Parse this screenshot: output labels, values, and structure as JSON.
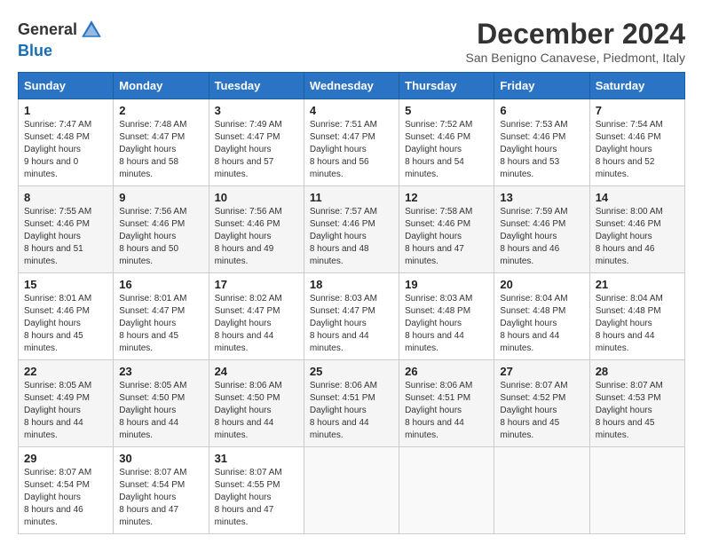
{
  "header": {
    "logo_line1": "General",
    "logo_line2": "Blue",
    "month_title": "December 2024",
    "location": "San Benigno Canavese, Piedmont, Italy"
  },
  "weekdays": [
    "Sunday",
    "Monday",
    "Tuesday",
    "Wednesday",
    "Thursday",
    "Friday",
    "Saturday"
  ],
  "weeks": [
    [
      {
        "day": "1",
        "sunrise": "7:47 AM",
        "sunset": "4:48 PM",
        "daylight": "9 hours and 0 minutes."
      },
      {
        "day": "2",
        "sunrise": "7:48 AM",
        "sunset": "4:47 PM",
        "daylight": "8 hours and 58 minutes."
      },
      {
        "day": "3",
        "sunrise": "7:49 AM",
        "sunset": "4:47 PM",
        "daylight": "8 hours and 57 minutes."
      },
      {
        "day": "4",
        "sunrise": "7:51 AM",
        "sunset": "4:47 PM",
        "daylight": "8 hours and 56 minutes."
      },
      {
        "day": "5",
        "sunrise": "7:52 AM",
        "sunset": "4:46 PM",
        "daylight": "8 hours and 54 minutes."
      },
      {
        "day": "6",
        "sunrise": "7:53 AM",
        "sunset": "4:46 PM",
        "daylight": "8 hours and 53 minutes."
      },
      {
        "day": "7",
        "sunrise": "7:54 AM",
        "sunset": "4:46 PM",
        "daylight": "8 hours and 52 minutes."
      }
    ],
    [
      {
        "day": "8",
        "sunrise": "7:55 AM",
        "sunset": "4:46 PM",
        "daylight": "8 hours and 51 minutes."
      },
      {
        "day": "9",
        "sunrise": "7:56 AM",
        "sunset": "4:46 PM",
        "daylight": "8 hours and 50 minutes."
      },
      {
        "day": "10",
        "sunrise": "7:56 AM",
        "sunset": "4:46 PM",
        "daylight": "8 hours and 49 minutes."
      },
      {
        "day": "11",
        "sunrise": "7:57 AM",
        "sunset": "4:46 PM",
        "daylight": "8 hours and 48 minutes."
      },
      {
        "day": "12",
        "sunrise": "7:58 AM",
        "sunset": "4:46 PM",
        "daylight": "8 hours and 47 minutes."
      },
      {
        "day": "13",
        "sunrise": "7:59 AM",
        "sunset": "4:46 PM",
        "daylight": "8 hours and 46 minutes."
      },
      {
        "day": "14",
        "sunrise": "8:00 AM",
        "sunset": "4:46 PM",
        "daylight": "8 hours and 46 minutes."
      }
    ],
    [
      {
        "day": "15",
        "sunrise": "8:01 AM",
        "sunset": "4:46 PM",
        "daylight": "8 hours and 45 minutes."
      },
      {
        "day": "16",
        "sunrise": "8:01 AM",
        "sunset": "4:47 PM",
        "daylight": "8 hours and 45 minutes."
      },
      {
        "day": "17",
        "sunrise": "8:02 AM",
        "sunset": "4:47 PM",
        "daylight": "8 hours and 44 minutes."
      },
      {
        "day": "18",
        "sunrise": "8:03 AM",
        "sunset": "4:47 PM",
        "daylight": "8 hours and 44 minutes."
      },
      {
        "day": "19",
        "sunrise": "8:03 AM",
        "sunset": "4:48 PM",
        "daylight": "8 hours and 44 minutes."
      },
      {
        "day": "20",
        "sunrise": "8:04 AM",
        "sunset": "4:48 PM",
        "daylight": "8 hours and 44 minutes."
      },
      {
        "day": "21",
        "sunrise": "8:04 AM",
        "sunset": "4:48 PM",
        "daylight": "8 hours and 44 minutes."
      }
    ],
    [
      {
        "day": "22",
        "sunrise": "8:05 AM",
        "sunset": "4:49 PM",
        "daylight": "8 hours and 44 minutes."
      },
      {
        "day": "23",
        "sunrise": "8:05 AM",
        "sunset": "4:50 PM",
        "daylight": "8 hours and 44 minutes."
      },
      {
        "day": "24",
        "sunrise": "8:06 AM",
        "sunset": "4:50 PM",
        "daylight": "8 hours and 44 minutes."
      },
      {
        "day": "25",
        "sunrise": "8:06 AM",
        "sunset": "4:51 PM",
        "daylight": "8 hours and 44 minutes."
      },
      {
        "day": "26",
        "sunrise": "8:06 AM",
        "sunset": "4:51 PM",
        "daylight": "8 hours and 44 minutes."
      },
      {
        "day": "27",
        "sunrise": "8:07 AM",
        "sunset": "4:52 PM",
        "daylight": "8 hours and 45 minutes."
      },
      {
        "day": "28",
        "sunrise": "8:07 AM",
        "sunset": "4:53 PM",
        "daylight": "8 hours and 45 minutes."
      }
    ],
    [
      {
        "day": "29",
        "sunrise": "8:07 AM",
        "sunset": "4:54 PM",
        "daylight": "8 hours and 46 minutes."
      },
      {
        "day": "30",
        "sunrise": "8:07 AM",
        "sunset": "4:54 PM",
        "daylight": "8 hours and 47 minutes."
      },
      {
        "day": "31",
        "sunrise": "8:07 AM",
        "sunset": "4:55 PM",
        "daylight": "8 hours and 47 minutes."
      },
      null,
      null,
      null,
      null
    ]
  ]
}
